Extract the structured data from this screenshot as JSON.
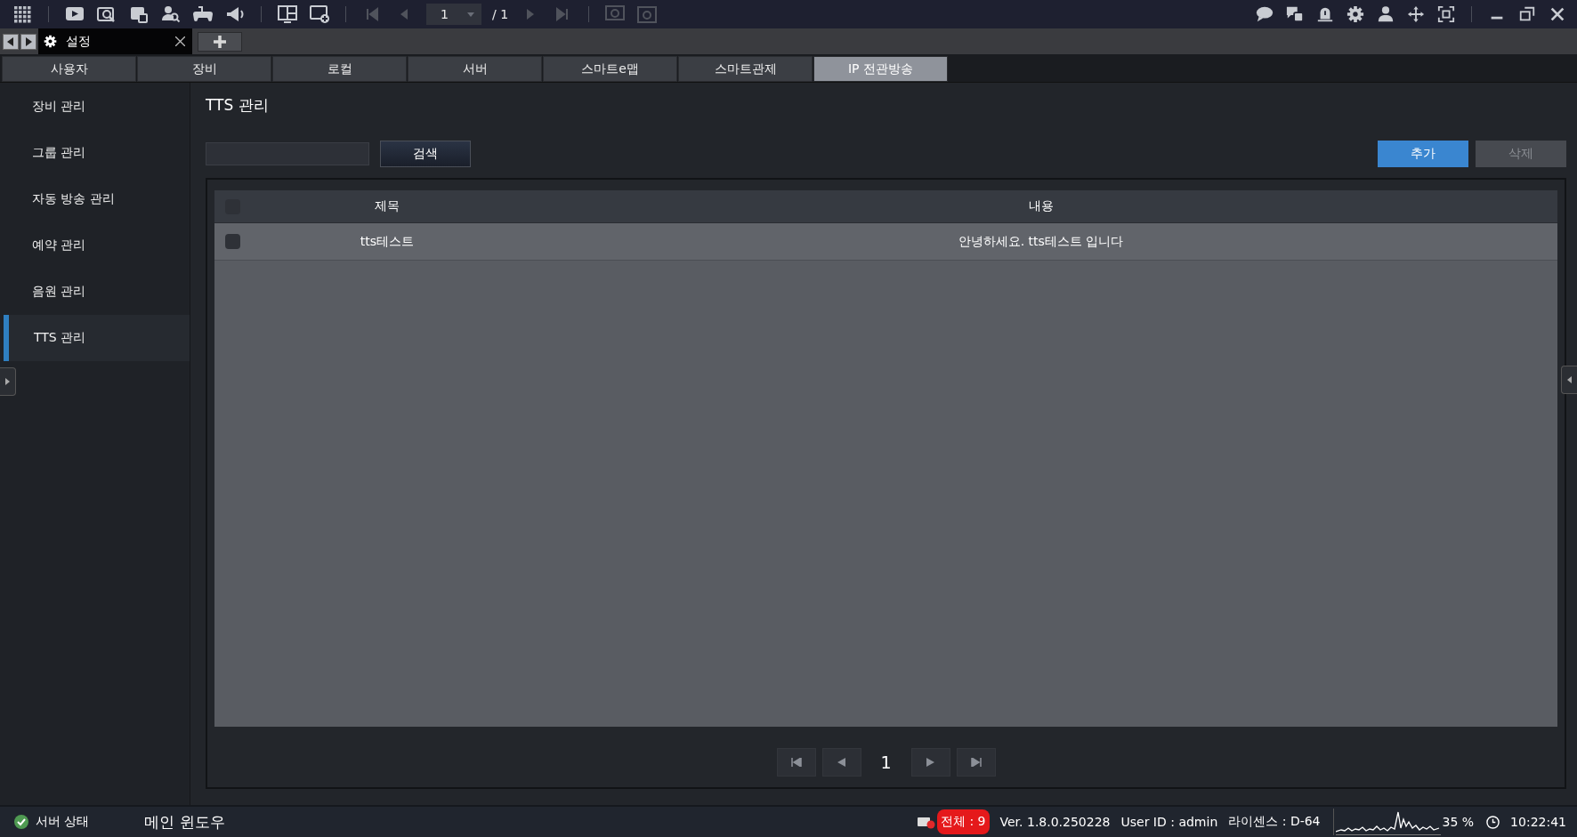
{
  "toolbar": {
    "page_field": {
      "value": "1"
    },
    "page_total": "/ 1"
  },
  "doc_tabs": [
    {
      "label": "설정",
      "selected": true
    }
  ],
  "category_tabs": [
    {
      "label": "사용자",
      "selected": false
    },
    {
      "label": "장비",
      "selected": false
    },
    {
      "label": "로컬",
      "selected": false
    },
    {
      "label": "서버",
      "selected": false
    },
    {
      "label": "스마트e맵",
      "selected": false
    },
    {
      "label": "스마트관제",
      "selected": false
    },
    {
      "label": "IP 전관방송",
      "selected": true
    }
  ],
  "sidebar": {
    "items": [
      {
        "label": "장비 관리",
        "selected": false
      },
      {
        "label": "그룹 관리",
        "selected": false
      },
      {
        "label": "자동 방송 관리",
        "selected": false
      },
      {
        "label": "예약 관리",
        "selected": false
      },
      {
        "label": "음원 관리",
        "selected": false
      },
      {
        "label": "TTS 관리",
        "selected": true
      }
    ]
  },
  "page_title": "TTS 관리",
  "search": {
    "button": "검색"
  },
  "actions": [
    {
      "label": "추가",
      "disabled": false
    },
    {
      "label": "삭제",
      "disabled": true
    }
  ],
  "table": {
    "header_checked": false,
    "columns": [
      "제목",
      "내용"
    ],
    "rows": [
      {
        "checked": false,
        "cells": [
          "tts테스트",
          "안녕하세요. tts테스트 입니다"
        ]
      }
    ]
  },
  "pagination": {
    "current": "1"
  },
  "status_bar": {
    "server_status": "서버 상태",
    "window_name": "메인 윈도우",
    "event_badge": "전체 : 9",
    "version": "Ver. 1.8.0.250228",
    "user": "User ID : admin",
    "license": "라이센스 : D-64",
    "cpu": "35 %",
    "time": "10:22:41"
  }
}
